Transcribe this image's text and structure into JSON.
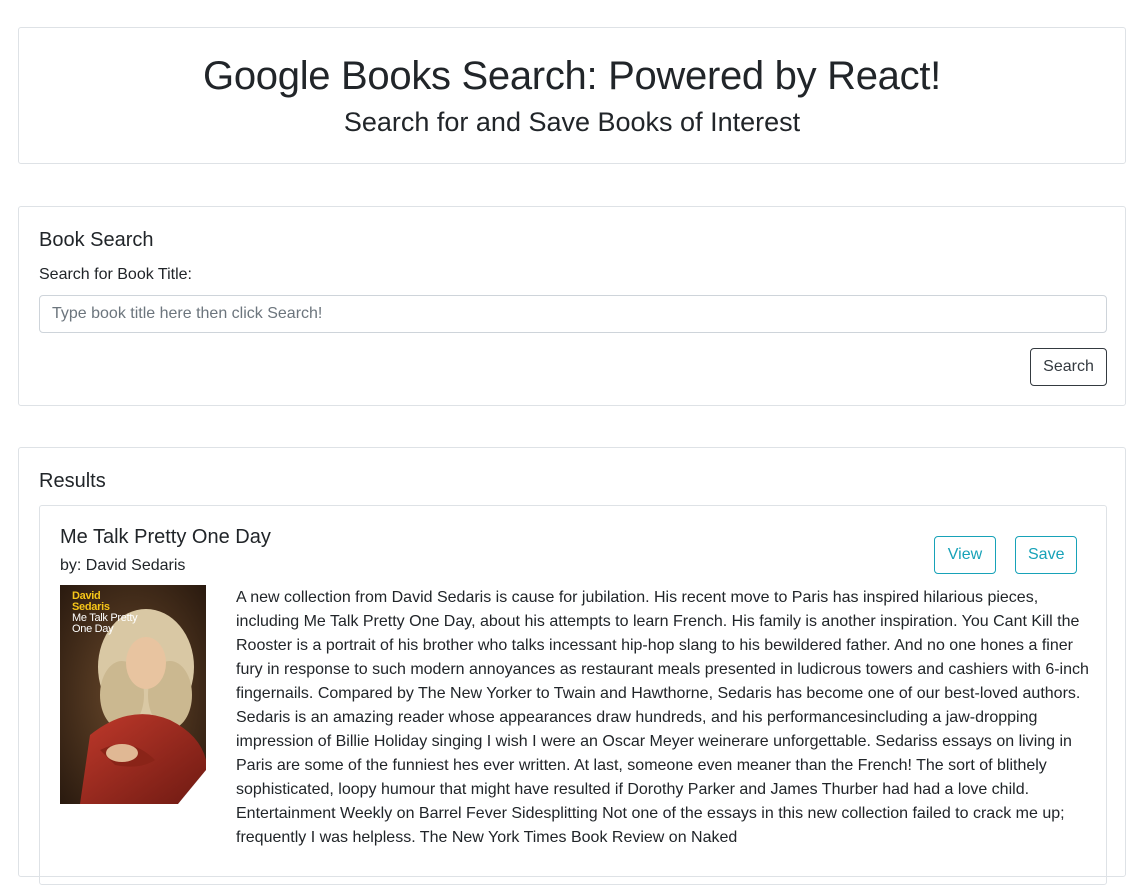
{
  "header": {
    "title": "Google Books Search: Powered by React!",
    "subtitle": "Search for and Save Books of Interest"
  },
  "search": {
    "heading": "Book Search",
    "label": "Search for Book Title:",
    "placeholder": "Type book title here then click Search!",
    "value": "",
    "button_label": "Search"
  },
  "results": {
    "heading": "Results",
    "books": [
      {
        "title": "Me Talk Pretty One Day",
        "author": "by: David Sedaris",
        "view_label": "View",
        "save_label": "Save",
        "cover": {
          "author_text": "David Sedaris",
          "title_text": "Me Talk Pretty One Day"
        },
        "description": "A new collection from David Sedaris is cause for jubilation. His recent move to Paris has inspired hilarious pieces, including Me Talk Pretty One Day, about his attempts to learn French. His family is another inspiration. You Cant Kill the Rooster is a portrait of his brother who talks incessant hip-hop slang to his bewildered father. And no one hones a finer fury in response to such modern annoyances as restaurant meals presented in ludicrous towers and cashiers with 6-inch fingernails. Compared by The New Yorker to Twain and Hawthorne, Sedaris has become one of our best-loved authors. Sedaris is an amazing reader whose appearances draw hundreds, and his performancesincluding a jaw-dropping impression of Billie Holiday singing I wish I were an Oscar Meyer weinerare unforgettable. Sedariss essays on living in Paris are some of the funniest hes ever written. At last, someone even meaner than the French! The sort of blithely sophisticated, loopy humour that might have resulted if Dorothy Parker and James Thurber had had a love child. Entertainment Weekly on Barrel Fever Sidesplitting Not one of the essays in this new collection failed to crack me up; frequently I was helpless. The New York Times Book Review on Naked"
      }
    ]
  },
  "colors": {
    "border": "#dee2e6",
    "info": "#17a2b8",
    "dark": "#343a40",
    "text": "#212529"
  }
}
